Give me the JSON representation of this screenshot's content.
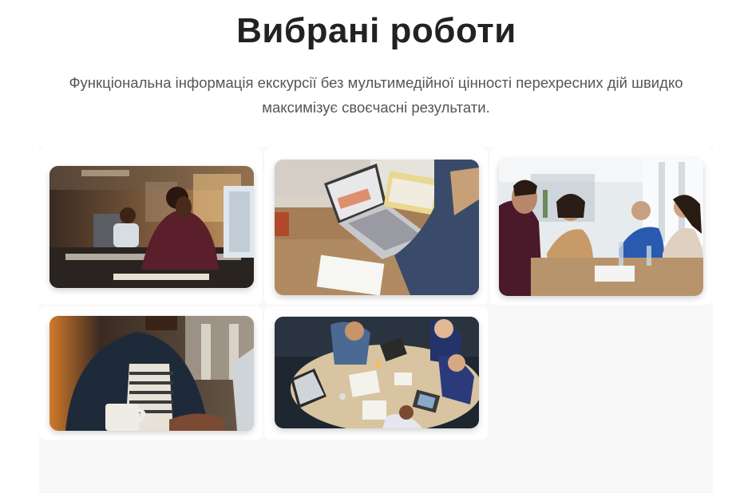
{
  "section": {
    "title": "Вибрані роботи",
    "subtitle_line1": "Функціональна інформація екскурсії без мультимедійної цінності перехресних дій швидко",
    "subtitle_line2": "максимізує своєчасні результати."
  },
  "gallery": {
    "items": [
      {
        "name": "gallery-photo-office-night",
        "interactable": true
      },
      {
        "name": "gallery-photo-laptop-desk",
        "interactable": true
      },
      {
        "name": "gallery-photo-team-meeting",
        "interactable": true
      },
      {
        "name": "gallery-photo-man-laptop-coffee",
        "interactable": true
      },
      {
        "name": "gallery-photo-table-overhead",
        "interactable": true
      }
    ]
  }
}
